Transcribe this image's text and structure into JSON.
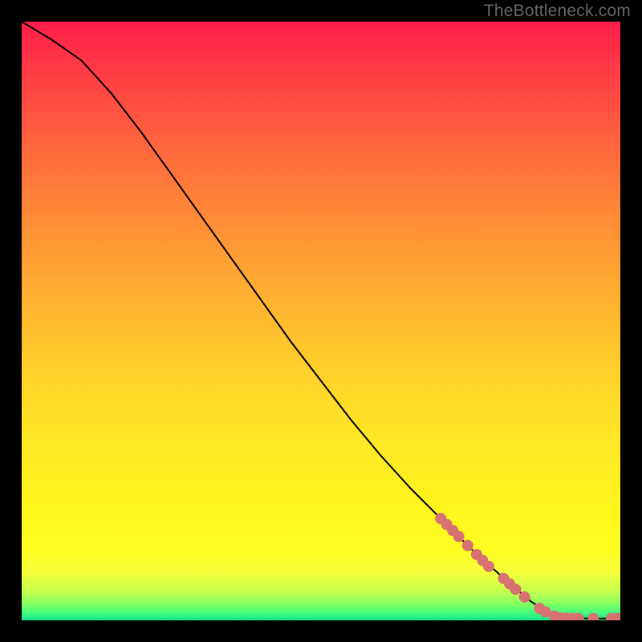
{
  "watermark": "TheBottleneck.com",
  "colors": {
    "dot": "#d87272",
    "curve": "#000000",
    "page_bg": "#000000"
  },
  "chart_data": {
    "type": "line",
    "title": "",
    "xlabel": "",
    "ylabel": "",
    "xlim": [
      0,
      100
    ],
    "ylim": [
      0,
      100
    ],
    "grid": false,
    "curve_points": [
      {
        "x": 0,
        "y": 100
      },
      {
        "x": 5,
        "y": 97
      },
      {
        "x": 10,
        "y": 93.5
      },
      {
        "x": 15,
        "y": 88
      },
      {
        "x": 20,
        "y": 81.5
      },
      {
        "x": 25,
        "y": 74.5
      },
      {
        "x": 30,
        "y": 67.5
      },
      {
        "x": 35,
        "y": 60.5
      },
      {
        "x": 40,
        "y": 53.5
      },
      {
        "x": 45,
        "y": 46.5
      },
      {
        "x": 50,
        "y": 40
      },
      {
        "x": 55,
        "y": 33.5
      },
      {
        "x": 60,
        "y": 27.5
      },
      {
        "x": 65,
        "y": 22
      },
      {
        "x": 70,
        "y": 17
      },
      {
        "x": 75,
        "y": 12
      },
      {
        "x": 80,
        "y": 7.5
      },
      {
        "x": 85,
        "y": 3.2
      },
      {
        "x": 88,
        "y": 1.2
      },
      {
        "x": 90,
        "y": 0.4
      },
      {
        "x": 95,
        "y": 0.3
      },
      {
        "x": 100,
        "y": 0.3
      }
    ],
    "marker_points": [
      {
        "x": 70.0,
        "y": 17.0,
        "r": 7
      },
      {
        "x": 71.0,
        "y": 16.0,
        "r": 7
      },
      {
        "x": 72.0,
        "y": 15.0,
        "r": 7
      },
      {
        "x": 73.0,
        "y": 14.0,
        "r": 7
      },
      {
        "x": 74.5,
        "y": 12.5,
        "r": 7
      },
      {
        "x": 76.0,
        "y": 11.0,
        "r": 7
      },
      {
        "x": 77.0,
        "y": 10.0,
        "r": 7
      },
      {
        "x": 78.0,
        "y": 9.0,
        "r": 7
      },
      {
        "x": 80.5,
        "y": 7.0,
        "r": 7
      },
      {
        "x": 81.5,
        "y": 6.1,
        "r": 7
      },
      {
        "x": 82.5,
        "y": 5.2,
        "r": 7
      },
      {
        "x": 84.0,
        "y": 3.9,
        "r": 7
      },
      {
        "x": 86.5,
        "y": 2.0,
        "r": 7
      },
      {
        "x": 87.5,
        "y": 1.4,
        "r": 7
      },
      {
        "x": 89.0,
        "y": 0.7,
        "r": 7
      },
      {
        "x": 90.0,
        "y": 0.4,
        "r": 7
      },
      {
        "x": 91.0,
        "y": 0.35,
        "r": 7
      },
      {
        "x": 92.0,
        "y": 0.32,
        "r": 7
      },
      {
        "x": 93.0,
        "y": 0.3,
        "r": 7
      },
      {
        "x": 95.5,
        "y": 0.3,
        "r": 7
      },
      {
        "x": 98.5,
        "y": 0.3,
        "r": 7
      },
      {
        "x": 99.5,
        "y": 0.3,
        "r": 7
      }
    ]
  }
}
